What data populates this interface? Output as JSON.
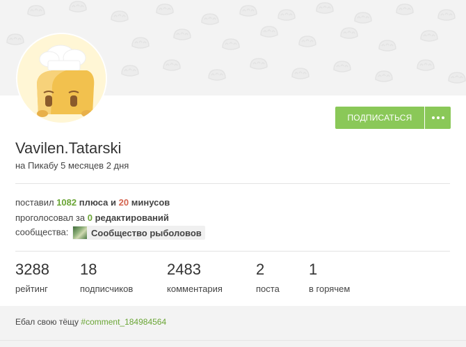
{
  "profile": {
    "username": "Vavilen.Tatarski",
    "since": "на Пикабу 5 месяцев 2 дня"
  },
  "actions": {
    "subscribe_label": "ПОДПИСАТЬСЯ",
    "more_label": "..."
  },
  "activity": {
    "votes_prefix": "поставил",
    "pluses": "1082",
    "pluses_word": "плюса",
    "and": "и",
    "minuses": "20",
    "minuses_word": "минусов",
    "edits_prefix": "проголосовал за",
    "edits_count": "0",
    "edits_word": "редактирований",
    "communities_label": "сообщества:",
    "community_name": "Сообщество рыболовов"
  },
  "stats": [
    {
      "value": "3288",
      "label": "рейтинг"
    },
    {
      "value": "18",
      "label": "подписчиков"
    },
    {
      "value": "2483",
      "label": "комментария"
    },
    {
      "value": "2",
      "label": "поста"
    },
    {
      "value": "1",
      "label": "в горячем"
    }
  ],
  "note": {
    "text": "Ебал свою тёщу",
    "tag": "#comment_184984564"
  },
  "colors": {
    "accent_green": "#8ac858",
    "plus_green": "#6aa535",
    "minus_red": "#d4644f"
  },
  "icons": {
    "avatar": "chef-cupcake-avatar",
    "community": "fishing-community-thumbnail",
    "more": "ellipsis-icon"
  }
}
